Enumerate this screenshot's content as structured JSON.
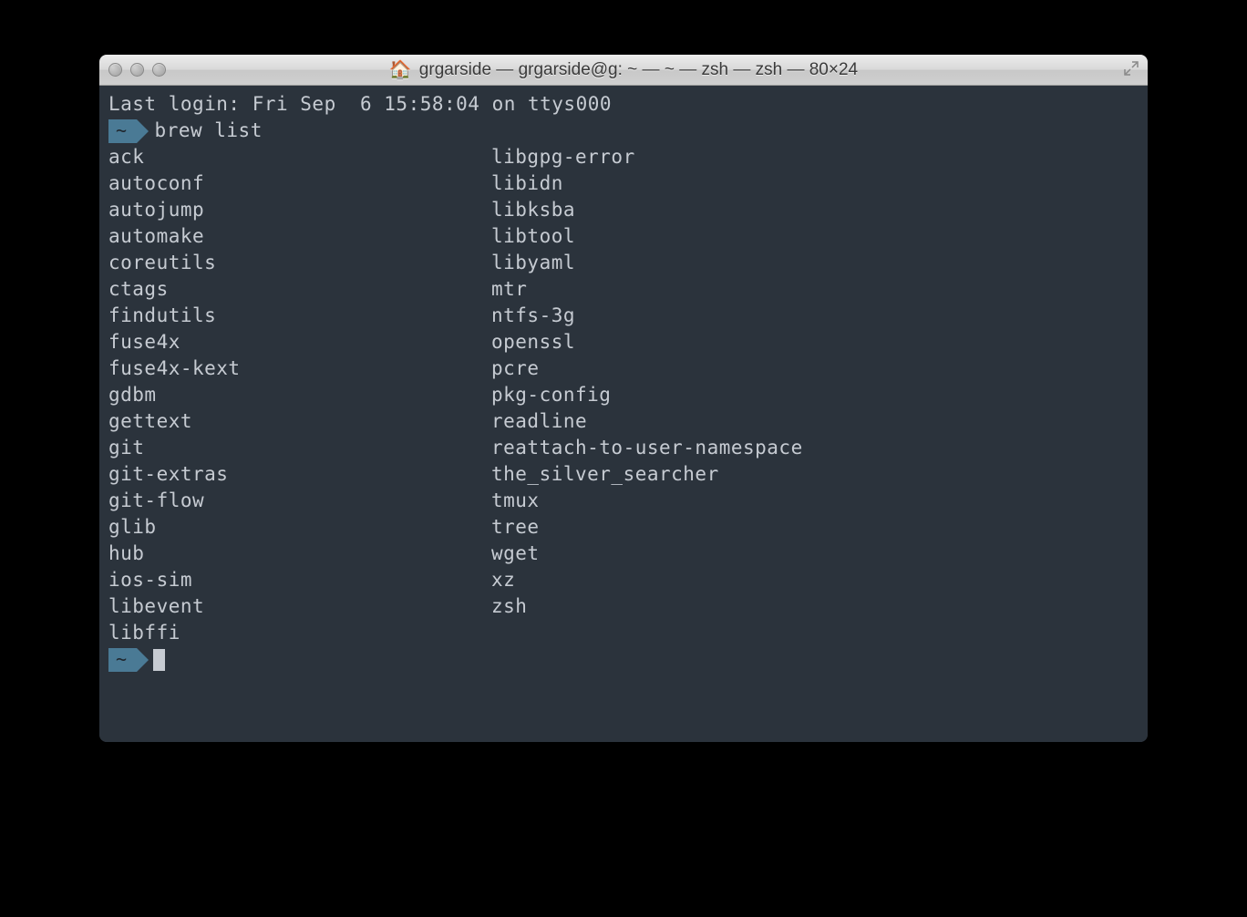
{
  "window": {
    "title": "grgarside — grgarside@g: ~ — ~ — zsh — zsh — 80×24"
  },
  "terminal": {
    "login_line": "Last login: Fri Sep  6 15:58:04 on ttys000",
    "prompt_symbol": "~",
    "command": "brew list",
    "output": {
      "col1": [
        "ack",
        "autoconf",
        "autojump",
        "automake",
        "coreutils",
        "ctags",
        "findutils",
        "fuse4x",
        "fuse4x-kext",
        "gdbm",
        "gettext",
        "git",
        "git-extras",
        "git-flow",
        "glib",
        "hub",
        "ios-sim",
        "libevent",
        "libffi"
      ],
      "col2": [
        "libgpg-error",
        "libidn",
        "libksba",
        "libtool",
        "libyaml",
        "mtr",
        "ntfs-3g",
        "openssl",
        "pcre",
        "pkg-config",
        "readline",
        "reattach-to-user-namespace",
        "the_silver_searcher",
        "tmux",
        "tree",
        "wget",
        "xz",
        "zsh"
      ]
    },
    "prompt_symbol2": "~"
  }
}
